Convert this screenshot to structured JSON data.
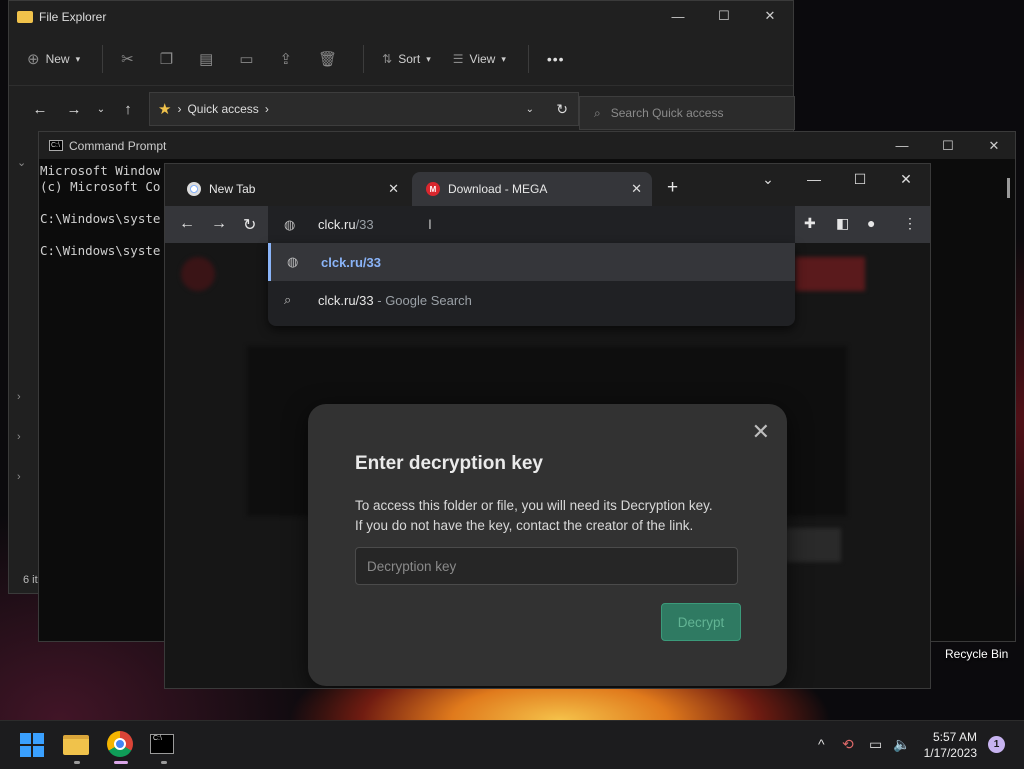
{
  "desktop": {
    "recycle_bin_label": "Recycle Bin"
  },
  "file_explorer": {
    "title": "File Explorer",
    "toolbar": {
      "new_label": "New",
      "sort_label": "Sort",
      "view_label": "View",
      "more": "•••"
    },
    "address": {
      "location": "Quick access",
      "star": "★"
    },
    "search_placeholder": "Search Quick access",
    "item_count": "6 it",
    "window_controls": {
      "minimize": "—",
      "maximize": "☐",
      "close": "✕"
    }
  },
  "command_prompt": {
    "title": "Command Prompt",
    "lines": [
      "Microsoft Window",
      "(c) Microsoft Co",
      "",
      "C:\\Windows\\syste",
      "",
      "",
      "C:\\Windows\\syste"
    ],
    "window_controls": {
      "minimize": "—",
      "maximize": "☐",
      "close": "✕"
    }
  },
  "chrome": {
    "tabs": [
      {
        "label": "New Tab",
        "close": "✕"
      },
      {
        "label": "Download - MEGA",
        "close": "✕",
        "favicon": "M"
      }
    ],
    "new_tab": "+",
    "window_controls": {
      "tab_search": "⌄",
      "minimize": "—",
      "maximize": "☐",
      "close": "✕"
    },
    "omnibox": {
      "typed": "clck.ru",
      "completion": "/33"
    },
    "suggestions": [
      {
        "text": "clck.ru/33",
        "icon": "globe-icon"
      },
      {
        "text": "clck.ru/33",
        "suffix": " - Google Search",
        "icon": "search-icon"
      }
    ],
    "modal": {
      "close": "✕",
      "title": "Enter decryption key",
      "description_line1": "To access this folder or file, you will need its Decryption key.",
      "description_line2": "If you do not have the key, contact the creator of the link.",
      "input_placeholder": "Decryption key",
      "button_label": "Decrypt"
    }
  },
  "taskbar": {
    "time": "5:57 AM",
    "date": "1/17/2023",
    "notification_count": "1",
    "tray_chevron": "^"
  }
}
